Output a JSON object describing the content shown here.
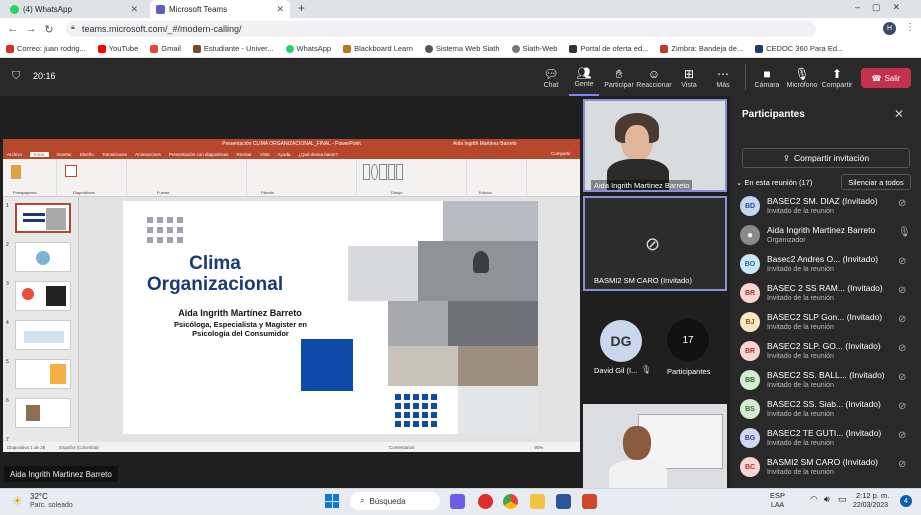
{
  "browser": {
    "tabs": [
      {
        "label": "(4) WhatsApp"
      },
      {
        "label": "Microsoft Teams"
      }
    ],
    "url": "teams.microsoft.com/_#/modern-calling/",
    "avatar": "H",
    "bookmarks": [
      "Correo: juan rodrig...",
      "YouTube",
      "Gmail",
      "Estudiante - Univer...",
      "WhatsApp",
      "Blackboard Learn",
      "Sistema Web Siath",
      "Siath-Web",
      "Portal de oferta ed...",
      "Zimbra: Bandeja de...",
      "CEDOC 360 Para Ed..."
    ]
  },
  "header": {
    "timer": "20:16",
    "actions": [
      {
        "label": "Chat",
        "icon": "chat-icon"
      },
      {
        "label": "Gente",
        "icon": "people-icon"
      },
      {
        "label": "Participar",
        "icon": "hand-icon"
      },
      {
        "label": "Reaccionar",
        "icon": "emoji-icon"
      },
      {
        "label": "Vista",
        "icon": "grid-icon"
      },
      {
        "label": "Más",
        "icon": "more-icon"
      }
    ],
    "media": [
      {
        "label": "Cámara",
        "icon": "camera-icon"
      },
      {
        "label": "Micrófono",
        "icon": "mic-off-icon"
      },
      {
        "label": "Compartir",
        "icon": "share-icon"
      }
    ],
    "leave_label": "Salir"
  },
  "ppt": {
    "window_title": "Presentación CLIMA ORGANIZACIONAL_FINAL - PowerPoint",
    "user": "Aida Ingrith Martinez Barreto",
    "menu": [
      "Archivo",
      "Inicio",
      "Insertar",
      "Diseño",
      "Transiciones",
      "Animaciones",
      "Presentación con diapositivas",
      "Revisar",
      "Vista",
      "Ayuda",
      "¿Qué desea hacer?"
    ],
    "share": "Compartir",
    "ribbon_groups": [
      "Portapapeles",
      "Diapositivas",
      "Fuente",
      "Párrafo",
      "Dibujo",
      "Edición"
    ],
    "slide_nums": [
      "1",
      "2",
      "3",
      "4",
      "5",
      "6",
      "7"
    ],
    "status_left": "Diapositiva 1 de 28",
    "status_lang": "Español (Colombia)",
    "status_right": "Comentarios",
    "zoom": "90%",
    "slide": {
      "title": "Clima Organizacional",
      "author": "Aida Ingrith Martínez Barreto",
      "subtitle": "Psicóloga, Especialista y Magister en Psicología del Consumidor"
    }
  },
  "presenter_label": "Aida Ingrith Martinez Barreto",
  "videos": {
    "tile1": "Aida Ingrith Martinez Barreto",
    "tile2": "BASMI2 SM CARO (Invitado)",
    "david_initials": "DG",
    "david_name": "David Gil (I...",
    "participants_count": "17",
    "participants_label": "Participantes"
  },
  "panel": {
    "title": "Participantes",
    "invite": "Compartir invitación",
    "section": "En esta reunión (17)",
    "mute_all": "Silenciar a todos",
    "people": [
      {
        "initials": "BD",
        "name": "BASEC2 SM. DIAZ (Invitado)",
        "role": "Invitado de la reunión",
        "color": "#c7d6f0",
        "text": "#2f4b8a"
      },
      {
        "initials": "",
        "name": "Aida Ingrith Martinez Barreto",
        "role": "Organizador",
        "color": "#8a8a8a",
        "text": "#fff"
      },
      {
        "initials": "BO",
        "name": "Basec2 Andres O... (Invitado)",
        "role": "Invitado de la reunión",
        "color": "#c9e7f5",
        "text": "#2a6f91"
      },
      {
        "initials": "BR",
        "name": "BASEC 2 SS RAM... (Invitado)",
        "role": "Invitado de la reunión",
        "color": "#f6d5d2",
        "text": "#a8392f"
      },
      {
        "initials": "BJ",
        "name": "BASEC2 SLP Gon... (Invitado)",
        "role": "Invitado de la reunión",
        "color": "#f8e6c4",
        "text": "#8a5b0d"
      },
      {
        "initials": "BR",
        "name": "BASEC2 SLP. GO... (Invitado)",
        "role": "Invitado de la reunión",
        "color": "#f6d5d2",
        "text": "#a8392f"
      },
      {
        "initials": "BB",
        "name": "BASEC2 SS. BALL... (Invitado)",
        "role": "Invitado de la reunión",
        "color": "#d6ecd2",
        "text": "#2f6d2a"
      },
      {
        "initials": "BS",
        "name": "BASEC2 SS. Siab... (Invitado)",
        "role": "Invitado de la reunión",
        "color": "#d6ecd2",
        "text": "#2f6d2a"
      },
      {
        "initials": "BG",
        "name": "BASEC2 TE GUTI... (Invitado)",
        "role": "Invitado de la reunión",
        "color": "#d3d7f2",
        "text": "#393f8f"
      },
      {
        "initials": "BC",
        "name": "BASMI2 SM CARO (Invitado)",
        "role": "Invitado de la reunión",
        "color": "#f6d5d2",
        "text": "#a8392f"
      }
    ]
  },
  "taskbar": {
    "temp": "32°C",
    "weather": "Parc. soleado",
    "search": "Búsqueda",
    "lang": "ESP",
    "lang2": "LAA",
    "time": "2:12 p. m.",
    "date": "22/03/2023",
    "badge": "4"
  }
}
